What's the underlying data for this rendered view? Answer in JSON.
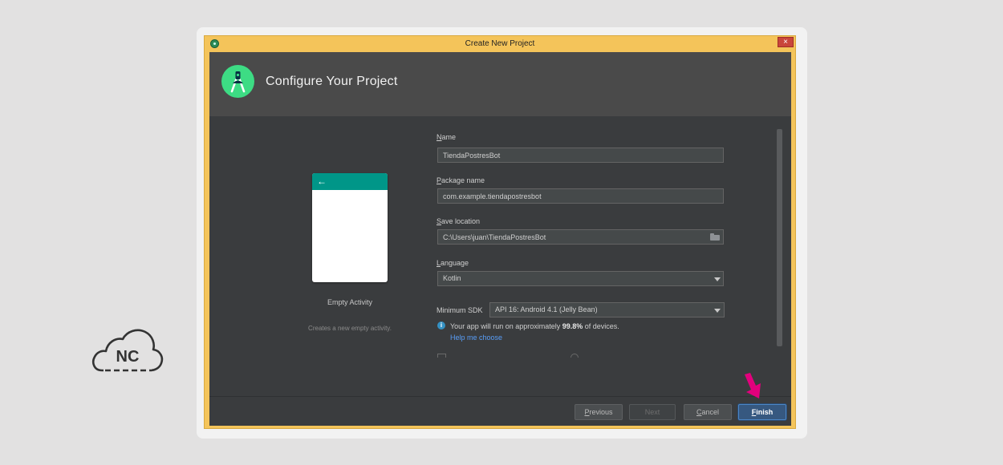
{
  "window": {
    "title": "Create New Project",
    "close_label": "×"
  },
  "header": {
    "title": "Configure Your Project"
  },
  "preview": {
    "back_arrow": "←",
    "activity_name": "Empty Activity",
    "activity_description": "Creates a new empty activity."
  },
  "form": {
    "name": {
      "label_accel": "N",
      "label_rest": "ame",
      "value": "TiendaPostresBot"
    },
    "package": {
      "label_accel": "P",
      "label_rest": "ackage name",
      "value": "com.example.tiendapostresbot"
    },
    "save_location": {
      "label_accel": "S",
      "label_rest": "ave location",
      "value": "C:\\Users\\juan\\TiendaPostresBot"
    },
    "language": {
      "label_accel": "L",
      "label_rest": "anguage",
      "value": "Kotlin"
    },
    "min_sdk": {
      "label": "Minimum SDK",
      "value": "API 16: Android 4.1 (Jelly Bean)"
    },
    "info": {
      "text_before": "Your app will run on approximately ",
      "percent": "99.8%",
      "text_after": " of devices.",
      "help_link": "Help me choose"
    }
  },
  "buttons": {
    "previous_accel": "P",
    "previous_rest": "revious",
    "next": "Next",
    "cancel_accel": "C",
    "cancel_rest": "ancel",
    "finish_accel": "F",
    "finish_rest": "inish"
  },
  "watermark": {
    "text": "NC"
  },
  "colors": {
    "window_frame": "#f4c45a",
    "android_green": "#3ddc84",
    "teal_bar": "#009688",
    "finish_button": "#365880",
    "link": "#589df6",
    "highlight_arrow": "#e3007d"
  }
}
